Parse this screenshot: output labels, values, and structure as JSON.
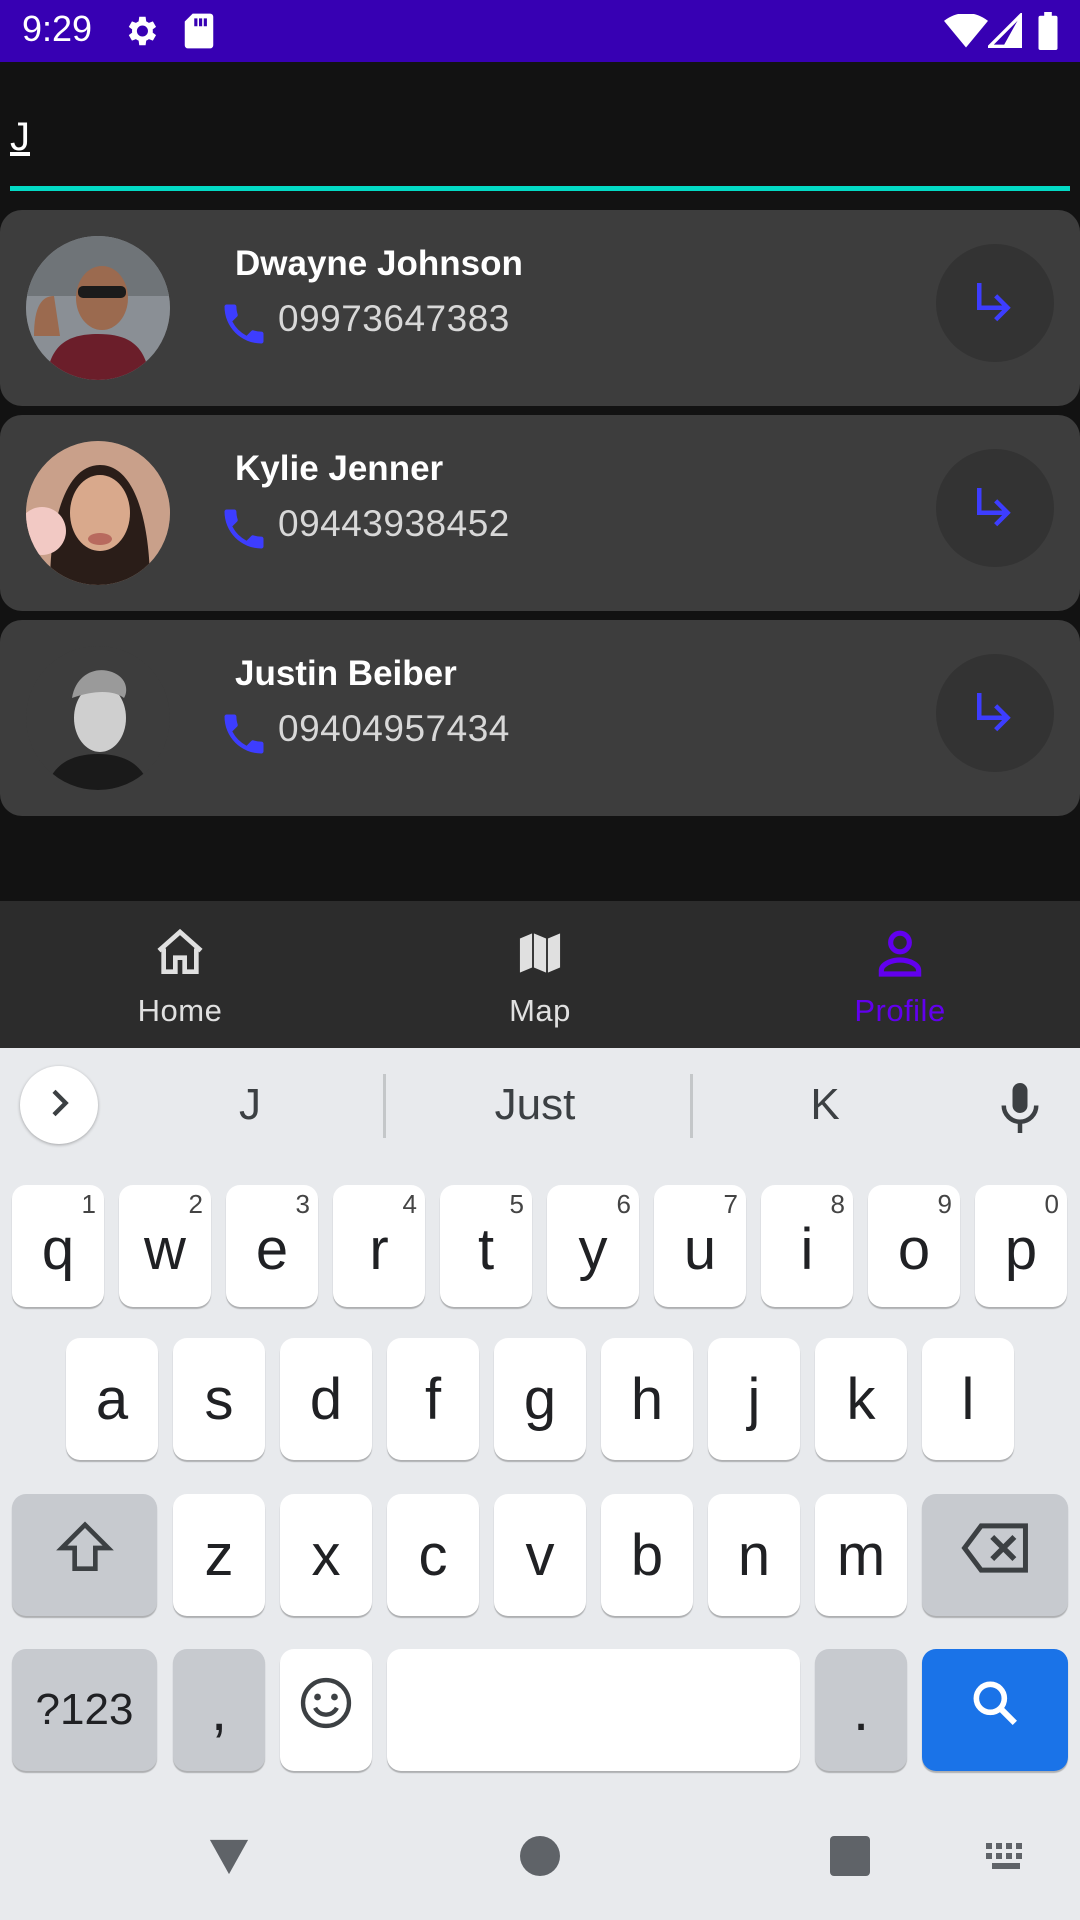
{
  "status_bar": {
    "time": "9:29",
    "icons": [
      "gear-icon",
      "sd-card-icon",
      "wifi-icon",
      "signal-icon",
      "battery-icon"
    ],
    "background": "#3700b3"
  },
  "search": {
    "value": "J",
    "underline_color": "#03dac5"
  },
  "contacts": [
    {
      "name": "Dwayne Johnson",
      "phone": "09973647383"
    },
    {
      "name": "Kylie Jenner",
      "phone": "09443938452"
    },
    {
      "name": "Justin Beiber",
      "phone": "09404957434"
    }
  ],
  "bottom_nav": {
    "items": [
      {
        "label": "Home",
        "icon": "home-icon",
        "active": false
      },
      {
        "label": "Map",
        "icon": "map-icon",
        "active": false
      },
      {
        "label": "Profile",
        "icon": "person-icon",
        "active": true
      }
    ],
    "active_color": "#6200ee",
    "inactive_color": "#e0e0e0"
  },
  "keyboard": {
    "suggestions": [
      "J",
      "Just",
      "K"
    ],
    "row1": [
      {
        "key": "q",
        "hint": "1"
      },
      {
        "key": "w",
        "hint": "2"
      },
      {
        "key": "e",
        "hint": "3"
      },
      {
        "key": "r",
        "hint": "4"
      },
      {
        "key": "t",
        "hint": "5"
      },
      {
        "key": "y",
        "hint": "6"
      },
      {
        "key": "u",
        "hint": "7"
      },
      {
        "key": "i",
        "hint": "8"
      },
      {
        "key": "o",
        "hint": "9"
      },
      {
        "key": "p",
        "hint": "0"
      }
    ],
    "row2": [
      "a",
      "s",
      "d",
      "f",
      "g",
      "h",
      "j",
      "k",
      "l"
    ],
    "row3": [
      "z",
      "x",
      "c",
      "v",
      "b",
      "n",
      "m"
    ],
    "symbols_label": "?123",
    "comma_label": ",",
    "period_label": ".",
    "accent_color": "#1a73e8"
  },
  "accent_color": "#3d3dff"
}
